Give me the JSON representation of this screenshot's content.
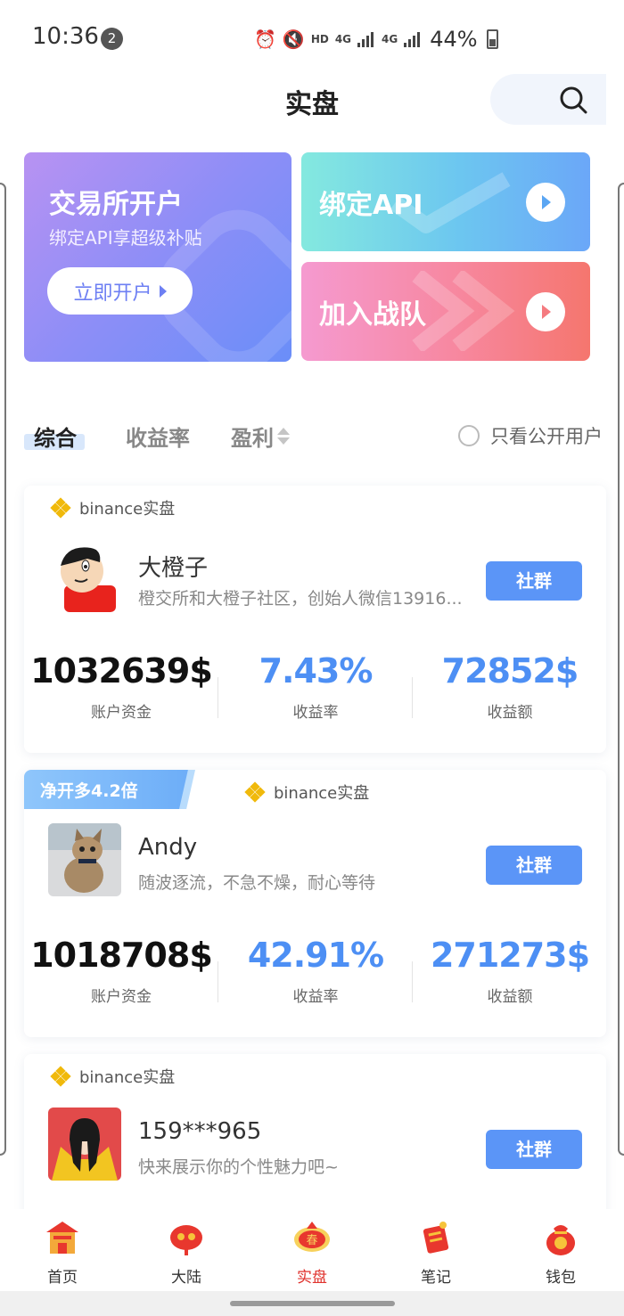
{
  "status_bar": {
    "time": "10:36",
    "notifications": "2",
    "hd": "HD",
    "net1": "4G",
    "net2": "4G",
    "battery": "44%"
  },
  "header": {
    "title": "实盘"
  },
  "banners": {
    "open_account": {
      "title": "交易所开户",
      "subtitle": "绑定API享超级补贴",
      "button": "立即开户"
    },
    "bind_api": {
      "label": "绑定API"
    },
    "join_team": {
      "label": "加入战队"
    }
  },
  "filters": {
    "tabs": [
      "综合",
      "收益率",
      "盈利"
    ],
    "active": "综合",
    "public_only": "只看公开用户"
  },
  "cards": [
    {
      "exchange": "binance实盘",
      "name": "大橙子",
      "bio": "橙交所和大橙子社区，创始人微信13916...",
      "button": "社群",
      "stats": [
        {
          "value": "1032639$",
          "label": "账户资金"
        },
        {
          "value": "7.43%",
          "label": "收益率"
        },
        {
          "value": "72852$",
          "label": "收益额"
        }
      ]
    },
    {
      "badge": "净开多4.2倍",
      "exchange": "binance实盘",
      "name": "Andy",
      "bio": "随波逐流，不急不燥，耐心等待",
      "button": "社群",
      "stats": [
        {
          "value": "1018708$",
          "label": "账户资金"
        },
        {
          "value": "42.91%",
          "label": "收益率"
        },
        {
          "value": "271273$",
          "label": "收益额"
        }
      ]
    },
    {
      "exchange": "binance实盘",
      "name": "159***965",
      "bio": "快来展示你的个性魅力吧~",
      "button": "社群"
    }
  ],
  "bottom_nav": [
    {
      "label": "首页",
      "icon": "home-icon"
    },
    {
      "label": "大陆",
      "icon": "mainland-icon"
    },
    {
      "label": "实盘",
      "icon": "live-trading-icon",
      "active": true
    },
    {
      "label": "笔记",
      "icon": "notes-icon"
    },
    {
      "label": "钱包",
      "icon": "wallet-icon"
    }
  ],
  "colors": {
    "accent_blue": "#5b95f7",
    "stat_blue": "#4d8ff4",
    "active_nav": "#e0332e",
    "binance_yellow": "#f0b90b"
  }
}
